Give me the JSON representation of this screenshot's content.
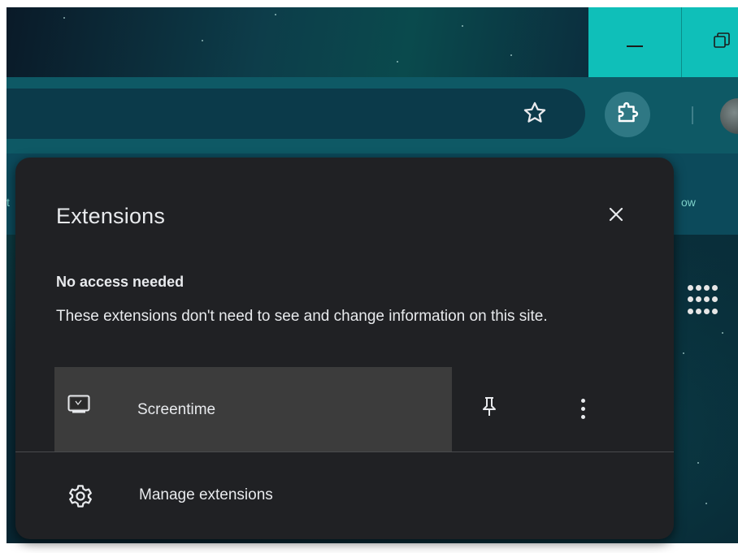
{
  "browser": {
    "bookmarks_partial": {
      "left": "t",
      "right": "ow"
    }
  },
  "popup": {
    "title": "Extensions",
    "close_glyph": "✕",
    "section": {
      "heading": "No access needed",
      "description": "These extensions don't need to see and change information on this site."
    },
    "extensions": [
      {
        "name": "Screentime",
        "icon": "screentime-icon"
      }
    ],
    "manage_label": "Manage extensions"
  },
  "icons": {
    "star": "star-icon",
    "extensions": "puzzle-icon",
    "minimize": "minimize-icon",
    "restore": "restore-icon",
    "pin": "pin-icon",
    "more": "more-vert-icon",
    "gear": "gear-icon",
    "apps": "apps-grid-icon"
  },
  "colors": {
    "accent": "#0fbfb9",
    "popup_bg": "#202124",
    "row_bg": "#3c3c3c"
  }
}
